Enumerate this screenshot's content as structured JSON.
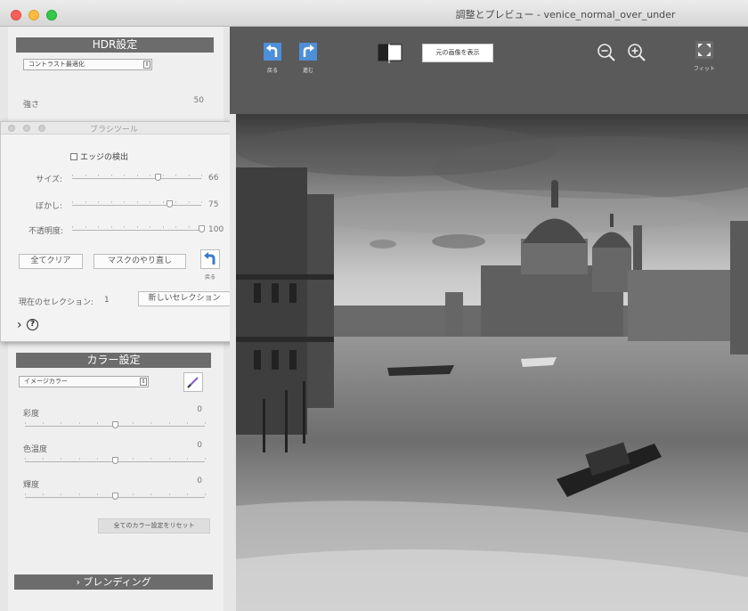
{
  "window": {
    "title": "調整とプレビュー - venice_normal_over_under"
  },
  "hdr": {
    "header": "HDR設定",
    "preset": "コントラスト最適化",
    "strength_label": "強さ",
    "strength_value": "50"
  },
  "brush_tool": {
    "title": "ブラシツール",
    "edge_detect_label": "エッジの検出",
    "size_label": "サイズ:",
    "size_value": "66",
    "size_level": 0.66,
    "blur_label": "ぼかし:",
    "blur_value": "75",
    "blur_level": 0.75,
    "opacity_label": "不透明度:",
    "opacity_value": "100",
    "opacity_level": 1.0,
    "clear_all": "全てクリア",
    "redo_mask": "マスクのやり直し",
    "back_label": "戻る",
    "selection_label": "現在のセレクション:",
    "selection_value": "1",
    "new_selection": "新しいセレクション",
    "expand_arrow": "›",
    "help_glyph": "?"
  },
  "color": {
    "header": "カラー設定",
    "preset": "イメージカラー",
    "saturation_label": "彩度",
    "saturation_value": "0",
    "temperature_label": "色温度",
    "temperature_value": "0",
    "brightness_label": "輝度",
    "brightness_value": "0",
    "reset": "全てのカラー設定をリセット"
  },
  "blending": {
    "header": "› ブレンディング"
  },
  "toolbar": {
    "undo_label": "戻る",
    "redo_label": "進む",
    "show_original": "元の画像を表示",
    "fit_label": "フィット"
  },
  "colors": {
    "toolbar_bg": "#5a5a5a",
    "section_header": "#6c6c6c",
    "accent_blue": "#3d7bc6"
  }
}
